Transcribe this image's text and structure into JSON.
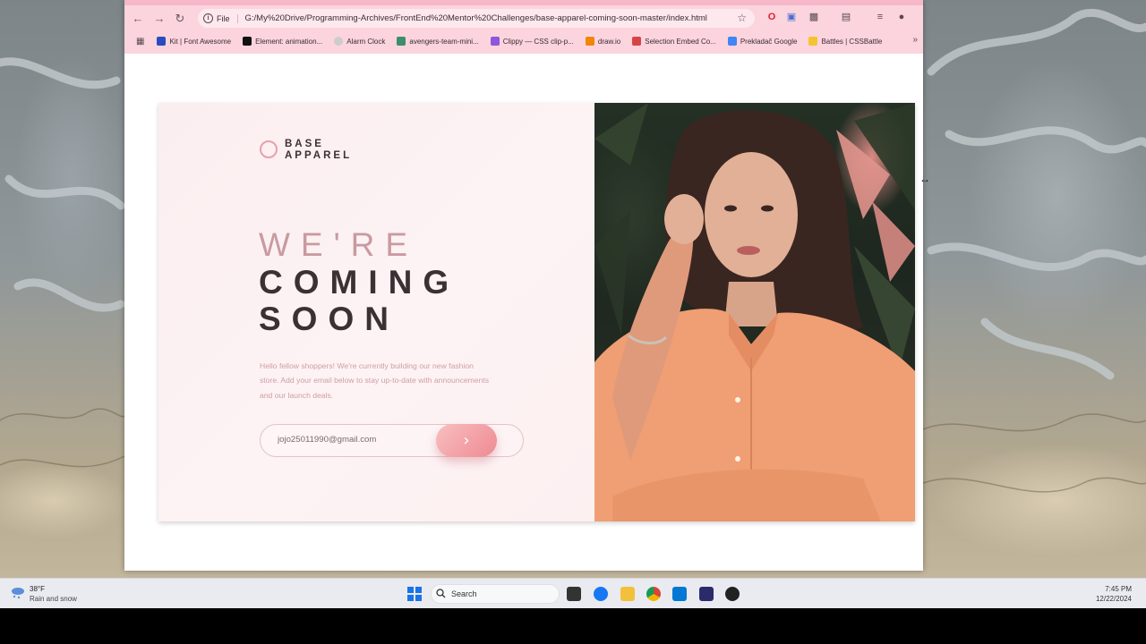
{
  "browser": {
    "omnibox": {
      "chip": "File",
      "url": "G:/My%20Drive/Programming-Archives/FrontEnd%20Mentor%20Challenges/base-apparel-coming-soon-master/index.html"
    },
    "bookmarks": [
      {
        "label": "Kit | Font Awesome",
        "icon": "font-awesome-icon",
        "color": "#2a4cbd"
      },
      {
        "label": "Element: animation...",
        "icon": "mdn-icon",
        "color": "#111111"
      },
      {
        "label": "Alarm Clock",
        "icon": "alarm-clock-icon",
        "color": "#bbbbbb"
      },
      {
        "label": "avengers-team-mini...",
        "icon": "image-icon",
        "color": "#3b8f6a"
      },
      {
        "label": "Clippy — CSS clip-p...",
        "icon": "clippy-icon",
        "color": "#8e57d9"
      },
      {
        "label": "draw.io",
        "icon": "drawio-icon",
        "color": "#f08705"
      },
      {
        "label": "Selection Embed Co...",
        "icon": "selection-embed-icon",
        "color": "#d64545"
      },
      {
        "label": "Prekladač Google",
        "icon": "google-translate-icon",
        "color": "#4285f4"
      },
      {
        "label": "Battles | CSSBattle",
        "icon": "cssbattle-icon",
        "color": "#f4c430"
      }
    ]
  },
  "page": {
    "logo": {
      "line1": "BASE",
      "line2": "APPAREL"
    },
    "heading": {
      "line1": "WE'RE",
      "line2": "COMING",
      "line3": "SOON"
    },
    "description": "Hello fellow shoppers! We're currently building our new fashion store. Add your email below to stay up-to-date with announcements and our launch deals.",
    "email_value": "jojo25011990@gmail.com",
    "submit_glyph": "›"
  },
  "taskbar": {
    "weather": {
      "temp": "38°F",
      "desc": "Rain and snow"
    },
    "search_label": "Search",
    "time": "7:45 PM",
    "date": "12/22/2024"
  },
  "colors": {
    "accent_pink": "#ee8a93",
    "heading_dark": "#3b3034",
    "heading_light": "#c99aa0",
    "description_text": "#cf9ea3",
    "browser_chrome": "#fbd4de"
  }
}
